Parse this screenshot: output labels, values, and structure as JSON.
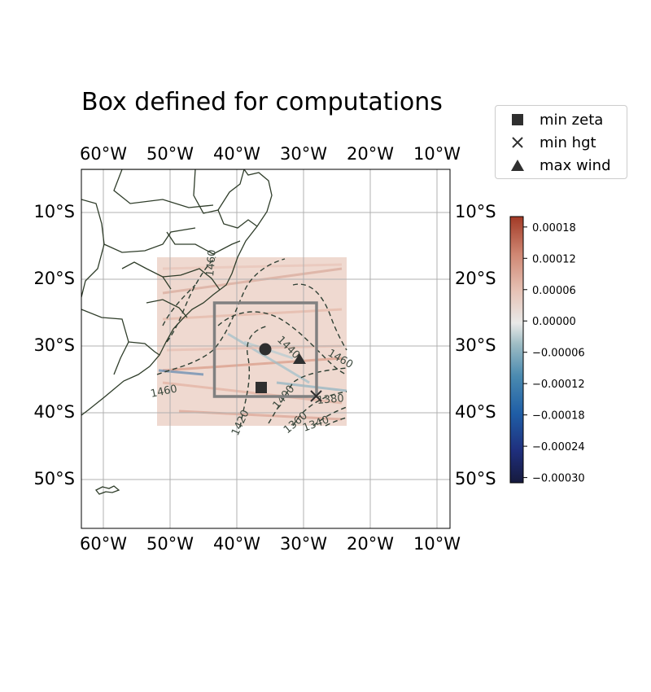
{
  "title": "Box defined for computations",
  "map": {
    "lon_ticks_top": [
      "60°W",
      "50°W",
      "40°W",
      "30°W",
      "20°W",
      "10°W"
    ],
    "lon_ticks_bottom": [
      "60°W",
      "50°W",
      "40°W",
      "30°W",
      "20°W",
      "10°W"
    ],
    "lat_ticks_left": [
      "10°S",
      "20°S",
      "30°S",
      "40°S",
      "50°S"
    ],
    "lat_ticks_right": [
      "10°S",
      "20°S",
      "30°S",
      "40°S",
      "50°S"
    ],
    "lon_range": [
      -63.3,
      -8
    ],
    "lat_range": [
      -57.5,
      -3.7
    ],
    "gridlines": true,
    "data_field_extent": {
      "lon": [
        -51.8,
        -23.5
      ],
      "lat": [
        -42.2,
        -16.8
      ]
    },
    "computation_box": {
      "lon": [
        -43.6,
        -27.9
      ],
      "lat": [
        -37.6,
        -23.6
      ]
    },
    "contour_labels": [
      "1460",
      "1440",
      "1460",
      "1400",
      "1380",
      "1360",
      "1340",
      "1420",
      "1460",
      "1380"
    ],
    "markers": [
      {
        "name": "min zeta",
        "symbol": "square",
        "lon": -36.3,
        "lat": -36.4
      },
      {
        "name": "min hgt",
        "symbol": "x",
        "lon": -28.0,
        "lat": -37.6
      },
      {
        "name": "max wind",
        "symbol": "triangle",
        "lon": -30.5,
        "lat": -32.0
      },
      {
        "name": "",
        "symbol": "circle",
        "lon": -35.6,
        "lat": -30.5
      }
    ]
  },
  "legend": {
    "items": [
      {
        "label": "min zeta",
        "symbol": "square"
      },
      {
        "label": "min hgt",
        "symbol": "x"
      },
      {
        "label": "max wind",
        "symbol": "triangle"
      }
    ]
  },
  "colorbar": {
    "ticks": [
      "0.00018",
      "0.00012",
      "0.00006",
      "0.00000",
      "−0.00006",
      "−0.00012",
      "−0.00018",
      "−0.00024",
      "−0.00030"
    ],
    "tick_values": [
      0.00018,
      0.00012,
      6e-05,
      0.0,
      -6e-05,
      -0.00012,
      -0.00018,
      -0.00024,
      -0.0003
    ],
    "range": [
      -0.00031,
      0.0002
    ]
  },
  "colors": {
    "land_outline": "#2f3d2a",
    "contour": "#2e3f33",
    "box": "#808080",
    "marker": "#2f2f2f",
    "cmap_high": "#a8432f",
    "cmap_zero": "#ecebea",
    "cmap_low": "#191c46"
  }
}
